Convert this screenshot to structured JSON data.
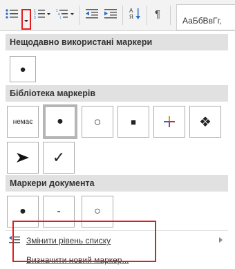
{
  "ribbon": {
    "styles_preview": "АаБбВвГг,"
  },
  "sections": {
    "recent": "Нещодавно використані маркери",
    "library": "Бібліотека маркерів",
    "document": "Маркери документа"
  },
  "recent_bullets": [
    "●"
  ],
  "library_bullets": [
    {
      "label": "немає",
      "icon": "none"
    },
    {
      "label": "●",
      "icon": "filled-circle",
      "selected": true
    },
    {
      "label": "○",
      "icon": "hollow-circle"
    },
    {
      "label": "■",
      "icon": "filled-square"
    },
    {
      "label": "✦",
      "icon": "four-color-star"
    },
    {
      "label": "❖",
      "icon": "four-diamond"
    },
    {
      "label": "➤",
      "icon": "arrow"
    },
    {
      "label": "✓",
      "icon": "checkmark"
    }
  ],
  "document_bullets": [
    "●",
    "-",
    "○"
  ],
  "menu_items": {
    "change_level": "Змінити рівень списку",
    "define_new": "Визначити новий маркер..."
  },
  "colors": {
    "highlight_border": "#e31b1b",
    "section_header_bg": "#e1e1e1"
  }
}
